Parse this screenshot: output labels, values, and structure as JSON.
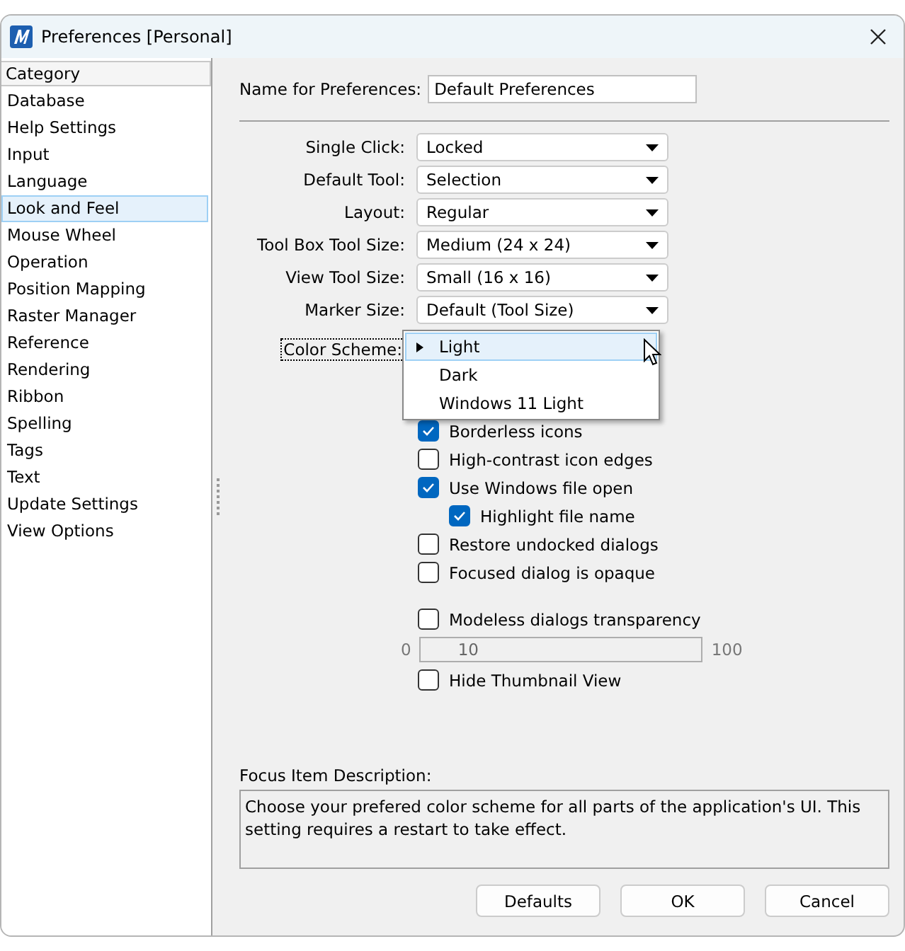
{
  "window": {
    "title": "Preferences [Personal]"
  },
  "sidebar": {
    "heading": "Category",
    "items": [
      {
        "label": "Database",
        "selected": false
      },
      {
        "label": "Help Settings",
        "selected": false
      },
      {
        "label": "Input",
        "selected": false
      },
      {
        "label": "Language",
        "selected": false
      },
      {
        "label": "Look and Feel",
        "selected": true
      },
      {
        "label": "Mouse Wheel",
        "selected": false
      },
      {
        "label": "Operation",
        "selected": false
      },
      {
        "label": "Position Mapping",
        "selected": false
      },
      {
        "label": "Raster Manager",
        "selected": false
      },
      {
        "label": "Reference",
        "selected": false
      },
      {
        "label": "Rendering",
        "selected": false
      },
      {
        "label": "Ribbon",
        "selected": false
      },
      {
        "label": "Spelling",
        "selected": false
      },
      {
        "label": "Tags",
        "selected": false
      },
      {
        "label": "Text",
        "selected": false
      },
      {
        "label": "Update Settings",
        "selected": false
      },
      {
        "label": "View Options",
        "selected": false
      }
    ]
  },
  "name_field": {
    "label": "Name for Preferences:",
    "value": "Default Preferences"
  },
  "dropdowns": [
    {
      "label": "Single Click:",
      "value": "Locked"
    },
    {
      "label": "Default Tool:",
      "value": "Selection"
    },
    {
      "label": "Layout:",
      "value": "Regular"
    },
    {
      "label": "Tool Box Tool Size:",
      "value": "Medium (24 x 24)"
    },
    {
      "label": "View Tool Size:",
      "value": "Small (16 x 16)"
    },
    {
      "label": "Marker Size:",
      "value": "Default (Tool Size)"
    }
  ],
  "color_scheme": {
    "label": "Color Scheme:",
    "options": [
      {
        "label": "Light",
        "selected": true
      },
      {
        "label": "Dark",
        "selected": false
      },
      {
        "label": "Windows 11 Light",
        "selected": false
      }
    ]
  },
  "checkboxes": [
    {
      "label": "Borderless icons",
      "checked": true
    },
    {
      "label": "High-contrast icon edges",
      "checked": false
    },
    {
      "label": "Use Windows file open",
      "checked": true,
      "children": [
        {
          "label": "Highlight file name",
          "checked": true
        }
      ]
    },
    {
      "label": "Restore undocked dialogs",
      "checked": false
    },
    {
      "label": "Focused dialog is opaque",
      "checked": false
    }
  ],
  "transparency": {
    "label": "Modeless dialogs transparency",
    "checked": false,
    "min_label": "0",
    "value": "10",
    "max_label": "100"
  },
  "thumbnail": {
    "label": "Hide Thumbnail View",
    "checked": false
  },
  "description": {
    "label": "Focus Item Description:",
    "text": "Choose your prefered color scheme for all parts of the application's UI. This setting requires a restart to take effect."
  },
  "buttons": [
    {
      "label": "Defaults"
    },
    {
      "label": "OK"
    },
    {
      "label": "Cancel"
    }
  ]
}
